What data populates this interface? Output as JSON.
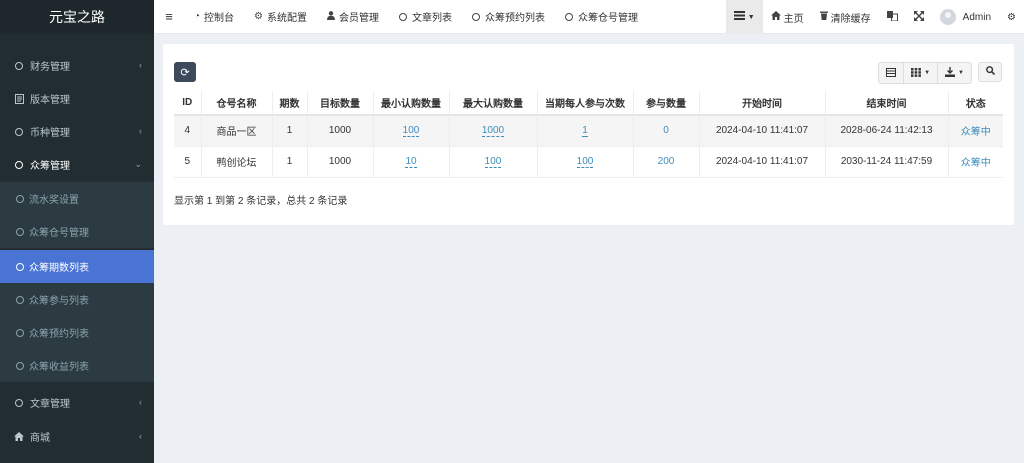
{
  "sidebar": {
    "brand": "元宝之路",
    "menu": [
      {
        "label": "财务管理",
        "caret": "‹"
      },
      {
        "label": "版本管理"
      },
      {
        "label": "币种管理",
        "caret": "‹"
      },
      {
        "label": "众筹管理",
        "caret": "⌄"
      }
    ],
    "submenu": [
      {
        "label": "流水奖设置"
      },
      {
        "label": "众筹仓号管理"
      },
      {
        "label": "众筹期数列表"
      },
      {
        "label": "众筹参与列表"
      },
      {
        "label": "众筹预约列表"
      },
      {
        "label": "众筹收益列表"
      }
    ],
    "menu_bottom": [
      {
        "label": "文章管理",
        "caret": "‹"
      },
      {
        "label": "商城",
        "caret": "‹"
      }
    ]
  },
  "topnav": {
    "items": [
      {
        "label": "控制台"
      },
      {
        "label": "系统配置"
      },
      {
        "label": "会员管理"
      },
      {
        "label": "文章列表"
      },
      {
        "label": "众筹预约列表"
      },
      {
        "label": "众筹仓号管理"
      }
    ],
    "right": {
      "home": "主页",
      "clear_cache": "清除缓存",
      "user": "Admin"
    }
  },
  "table": {
    "headers": [
      "ID",
      "仓号名称",
      "期数",
      "目标数量",
      "最小认购数量",
      "最大认购数量",
      "当期每人参与次数",
      "参与数量",
      "开始时间",
      "结束时间",
      "状态"
    ],
    "rows": [
      {
        "id": "4",
        "name": "商品一区",
        "period": "1",
        "target": "1000",
        "min": "100",
        "max": "1000",
        "times": "1",
        "joined": "0",
        "start": "2024-04-10 11:41:07",
        "end": "2028-06-24 11:42:13",
        "status": "众筹中"
      },
      {
        "id": "5",
        "name": "鸭创论坛",
        "period": "1",
        "target": "1000",
        "min": "10",
        "max": "100",
        "times": "100",
        "joined": "200",
        "start": "2024-04-10 11:41:07",
        "end": "2030-11-24 11:47:59",
        "status": "众筹中"
      }
    ],
    "pagination_info": "显示第 1 到第 2 条记录，总共 2 条记录"
  },
  "colors": {
    "sidebar_bg": "#222d32",
    "active_item": "#4a74d4",
    "link": "#3c8dbc"
  }
}
